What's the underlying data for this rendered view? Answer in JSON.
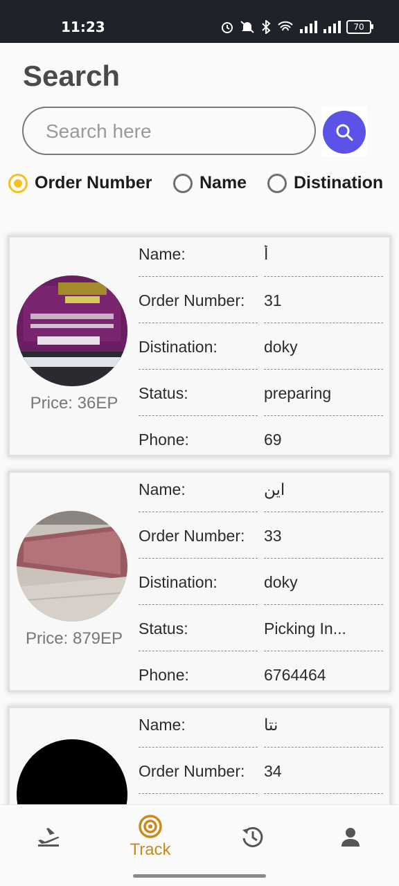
{
  "status_bar": {
    "time": "11:23",
    "battery": "70"
  },
  "page": {
    "title": "Search"
  },
  "search": {
    "placeholder": "Search here"
  },
  "filters": [
    {
      "label": "Order Number",
      "selected": true
    },
    {
      "label": "Name",
      "selected": false
    },
    {
      "label": "Distination",
      "selected": false
    }
  ],
  "orders": [
    {
      "price": "Price: 36EP",
      "rows": [
        {
          "label": "Name:",
          "value": "أ"
        },
        {
          "label": "Order Number:",
          "value": "31"
        },
        {
          "label": "Distination:",
          "value": "doky"
        },
        {
          "label": "Status:",
          "value": "preparing"
        },
        {
          "label": "Phone:",
          "value": "69"
        }
      ]
    },
    {
      "price": "Price: 879EP",
      "rows": [
        {
          "label": "Name:",
          "value": "اين"
        },
        {
          "label": "Order Number:",
          "value": "33"
        },
        {
          "label": "Distination:",
          "value": "doky"
        },
        {
          "label": "Status:",
          "value": "Picking In..."
        },
        {
          "label": "Phone:",
          "value": "6764464"
        }
      ]
    },
    {
      "price": "",
      "rows": [
        {
          "label": "Name:",
          "value": "نتا"
        },
        {
          "label": "Order Number:",
          "value": "34"
        }
      ]
    }
  ],
  "bottom_nav": [
    {
      "icon": "plane-icon",
      "label": ""
    },
    {
      "icon": "track-icon",
      "label": "Track",
      "active": true
    },
    {
      "icon": "history-icon",
      "label": ""
    },
    {
      "icon": "person-icon",
      "label": ""
    }
  ],
  "colors": {
    "accent": "#5b52e8",
    "selected": "#f6c11c",
    "nav_active": "#c98a1a"
  }
}
